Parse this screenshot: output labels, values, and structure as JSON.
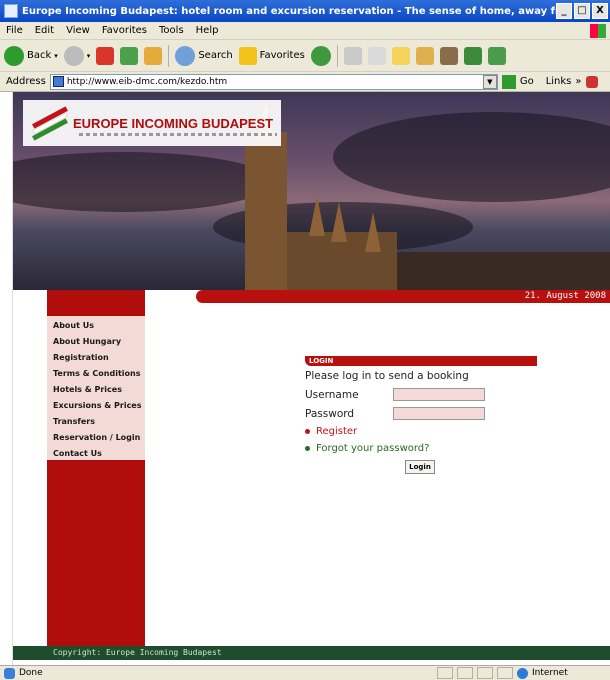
{
  "window": {
    "title": "Europe Incoming Budapest: hotel room and excursion reservation - The sense of home, away from h - Microsoft Internet ...",
    "controls": [
      "_",
      "□",
      "X"
    ]
  },
  "menu": [
    "File",
    "Edit",
    "View",
    "Favorites",
    "Tools",
    "Help"
  ],
  "toolbar": {
    "back": "Back",
    "search": "Search",
    "favorites": "Favorites"
  },
  "address": {
    "label": "Address",
    "url": "http://www.eib-dmc.com/kezdo.htm",
    "go": "Go",
    "links": "Links"
  },
  "site": {
    "brand": "EUROPE INCOMING BUDAPEST",
    "date": "21. August 2008",
    "nav": [
      "About Us",
      "About Hungary",
      "Registration",
      "Terms & Conditions",
      "Hotels & Prices",
      "Excursions & Prices",
      "Transfers",
      "Reservation / Login",
      "Contact Us"
    ],
    "login": {
      "heading": "LOGIN",
      "intro": "Please log in to send a booking",
      "username_label": "Username",
      "username_value": "",
      "password_label": "Password",
      "password_value": "",
      "register": "Register",
      "forgot": "Forgot your password?",
      "button": "Login"
    },
    "footer": "Copyright: Europe Incoming Budapest"
  },
  "status": {
    "left": "Done",
    "zone": "Internet"
  },
  "colors": {
    "brand_red": "#b80f0f",
    "link_red": "#c0141a",
    "link_green": "#2a6a22",
    "footer_green": "#1e4c2c"
  }
}
